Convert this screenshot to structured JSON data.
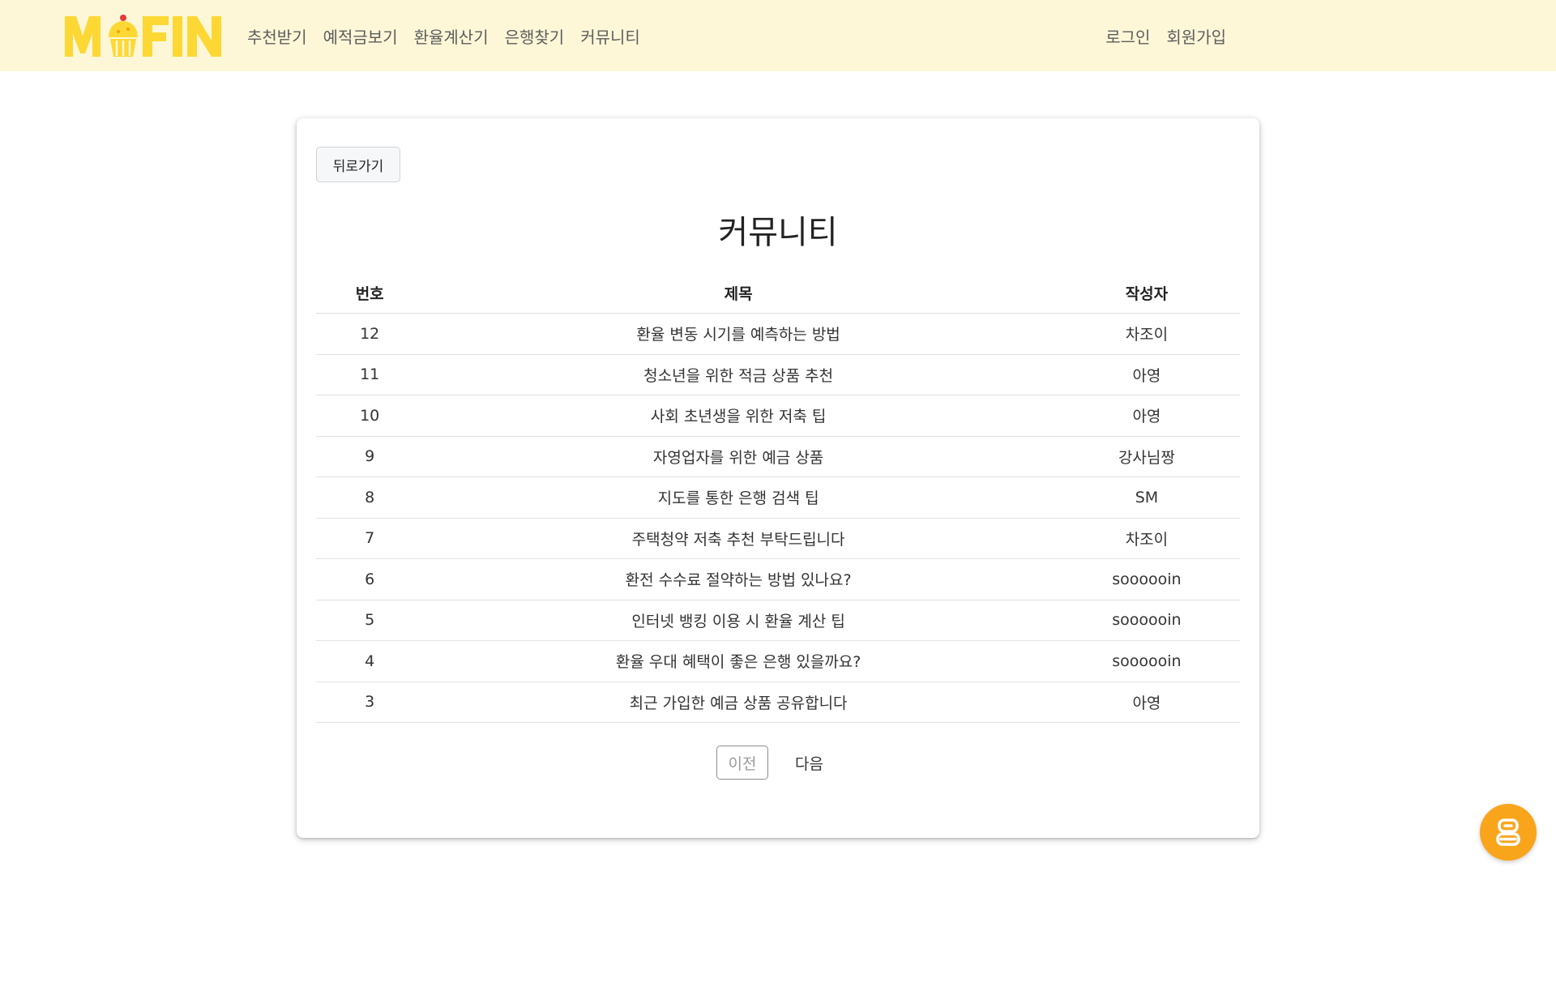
{
  "header": {
    "logo_text": "MFIN",
    "nav_left": [
      "추천받기",
      "예적금보기",
      "환율계산기",
      "은행찾기",
      "커뮤니티"
    ],
    "nav_right": [
      "로그인",
      "회원가입"
    ]
  },
  "card": {
    "back_label": "뒤로가기",
    "title": "커뮤니티",
    "columns": [
      "번호",
      "제목",
      "작성자"
    ],
    "rows": [
      {
        "num": "12",
        "title": "환율 변동 시기를 예측하는 방법",
        "author": "차조이"
      },
      {
        "num": "11",
        "title": "청소년을 위한 적금 상품 추천",
        "author": "아영"
      },
      {
        "num": "10",
        "title": "사회 초년생을 위한 저축 팁",
        "author": "아영"
      },
      {
        "num": "9",
        "title": "자영업자를 위한 예금 상품",
        "author": "강사님짱"
      },
      {
        "num": "8",
        "title": "지도를 통한 은행 검색 팁",
        "author": "SM"
      },
      {
        "num": "7",
        "title": "주택청약 저축 추천 부탁드립니다",
        "author": "차조이"
      },
      {
        "num": "6",
        "title": "환전 수수료 절약하는 방법 있나요?",
        "author": "soooooin"
      },
      {
        "num": "5",
        "title": "인터넷 뱅킹 이용 시 환율 계산 팁",
        "author": "soooooin"
      },
      {
        "num": "4",
        "title": "환율 우대 혜택이 좋은 은행 있을까요?",
        "author": "soooooin"
      },
      {
        "num": "3",
        "title": "최근 가입한 예금 상품 공유합니다",
        "author": "아영"
      }
    ],
    "pager": {
      "prev_label": "이전",
      "next_label": "다음"
    }
  },
  "colors": {
    "header_bg": "#fdf7d8",
    "logo_yellow": "#fdd835",
    "chatbot_orange": "#f9a51c"
  },
  "icons": {
    "logo_cupcake": "cupcake-icon",
    "chatbot": "robot-icon"
  }
}
